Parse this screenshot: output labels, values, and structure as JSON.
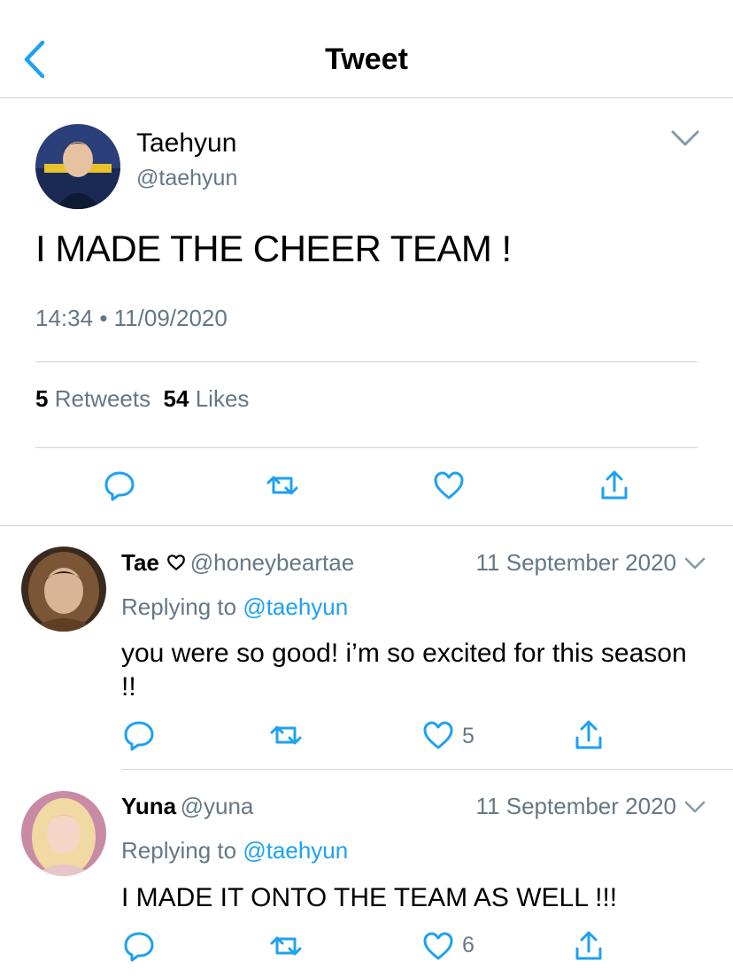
{
  "header": {
    "title": "Tweet",
    "back_icon": "chevron-left-icon"
  },
  "colors": {
    "accent": "#1DA1F2",
    "secondary_text": "#657786",
    "divider": "#cfd4d8"
  },
  "main_tweet": {
    "name": "Taehyun",
    "handle": "@taehyun",
    "text": "I MADE THE CHEER TEAM !",
    "time": "14:34",
    "separator": "•",
    "date": "11/09/2020",
    "retweets_count": "5",
    "retweets_label": "Retweets",
    "likes_count": "54",
    "likes_label": "Likes"
  },
  "replies": [
    {
      "name": "Tae",
      "name_icon": "heart-outline-icon",
      "handle": "@honeybeartae",
      "date": "11 September 2020",
      "replying_label": "Replying to",
      "replying_to": "@taehyun",
      "text": "you were so good! i’m so excited for this season !!",
      "like_count": "5"
    },
    {
      "name": "Yuna",
      "handle": "@yuna",
      "date": "11 September 2020",
      "replying_label": "Replying to",
      "replying_to": "@taehyun",
      "text": "I MADE IT ONTO THE TEAM AS WELL !!!",
      "like_count": "6"
    }
  ]
}
